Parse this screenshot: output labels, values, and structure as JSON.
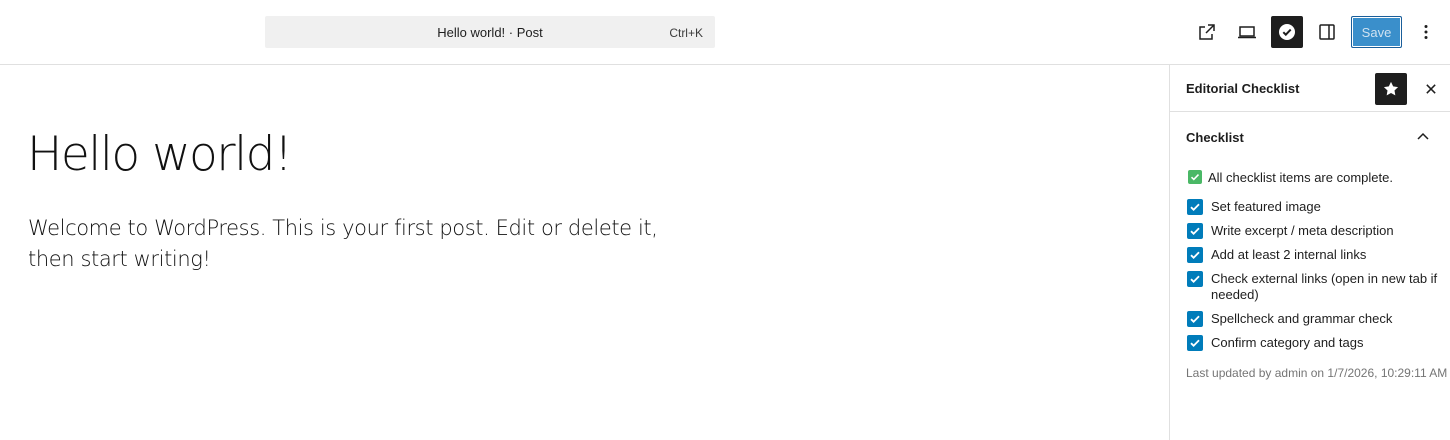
{
  "command_bar": {
    "title": "Hello world! · Post",
    "shortcut": "Ctrl+K"
  },
  "toolbar": {
    "view_icon": "external-link-icon",
    "preview_icon": "laptop-icon",
    "checklist_icon": "check-circle-icon",
    "settings_icon": "sidebar-toggle-icon",
    "save_label": "Save",
    "more_icon": "vertical-ellipsis-icon",
    "accent_color": "#3a8fcb"
  },
  "editor": {
    "title": "Hello world!",
    "body": "Welcome to WordPress. This is your first post. Edit or delete it, then start writing!"
  },
  "sidebar": {
    "title": "Editorial Checklist",
    "pin_icon": "star-icon",
    "close_icon": "close-icon",
    "panel": {
      "title": "Checklist",
      "expanded": true,
      "status": "All checklist items are complete.",
      "status_color": "#4ab866",
      "items": [
        {
          "label": "Set featured image",
          "checked": true
        },
        {
          "label": "Write excerpt / meta description",
          "checked": true
        },
        {
          "label": "Add at least 2 internal links",
          "checked": true
        },
        {
          "label": "Check external links (open in new tab if needed)",
          "checked": true
        },
        {
          "label": "Spellcheck and grammar check",
          "checked": true
        },
        {
          "label": "Confirm category and tags",
          "checked": true
        }
      ],
      "checkbox_color": "#007cba",
      "last_updated": "Last updated by admin on 1/7/2026, 10:29:11 AM"
    }
  }
}
